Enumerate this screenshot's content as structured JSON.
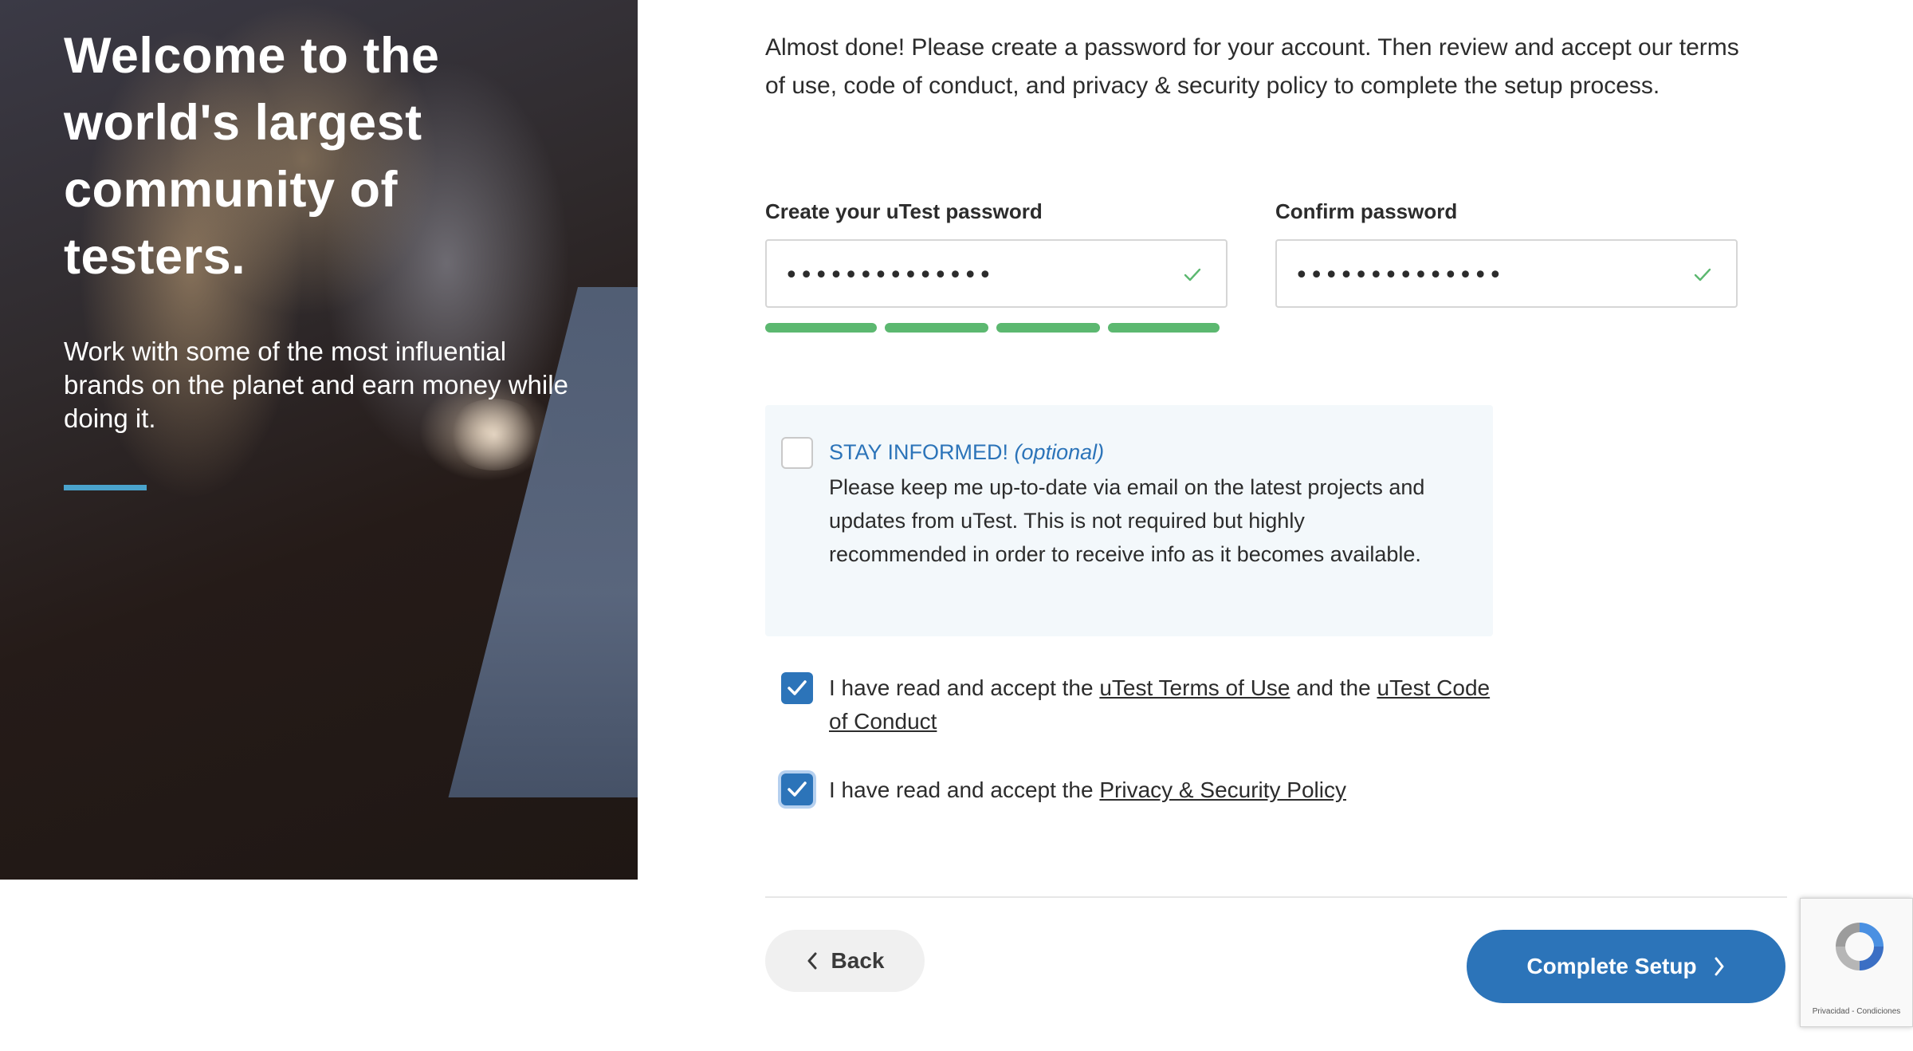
{
  "hero": {
    "title": "Welcome to the world's largest community of testers.",
    "subtitle": "Work with some of the most influential brands on the planet and earn money while doing it.",
    "accent_color": "#4aa3cc"
  },
  "form": {
    "intro": "Almost done! Please create a password for your account. Then review and accept our terms of use, code of conduct, and privacy & security policy to complete the setup process.",
    "password": {
      "label": "Create your uTest password",
      "value": "••••••••••••••",
      "status_icon": "check-icon"
    },
    "confirm": {
      "label": "Confirm password",
      "value": "••••••••••••••",
      "status_icon": "check-icon"
    },
    "strength_meter": {
      "segments_filled": 4,
      "segments_total": 4,
      "color": "#5cb870"
    },
    "stay_informed": {
      "checked": false,
      "title": "STAY INFORMED!",
      "optional": "(optional)",
      "body": "Please keep me up-to-date via email on the latest projects and updates from uTest. This is not required but highly recommended in order to receive info as it becomes available."
    },
    "terms": {
      "checked": true,
      "prefix": "I have read and accept the",
      "terms_link": "uTest Terms of Use",
      "middle": "and the",
      "code_link": "uTest Code of Conduct"
    },
    "privacy": {
      "checked": true,
      "prefix": "I have read and accept the",
      "privacy_link": "Privacy & Security Policy"
    }
  },
  "buttons": {
    "back": "Back",
    "complete": "Complete Setup",
    "primary_color": "#2c74b9"
  },
  "recaptcha": {
    "links": "Privacidad - Condiciones"
  }
}
